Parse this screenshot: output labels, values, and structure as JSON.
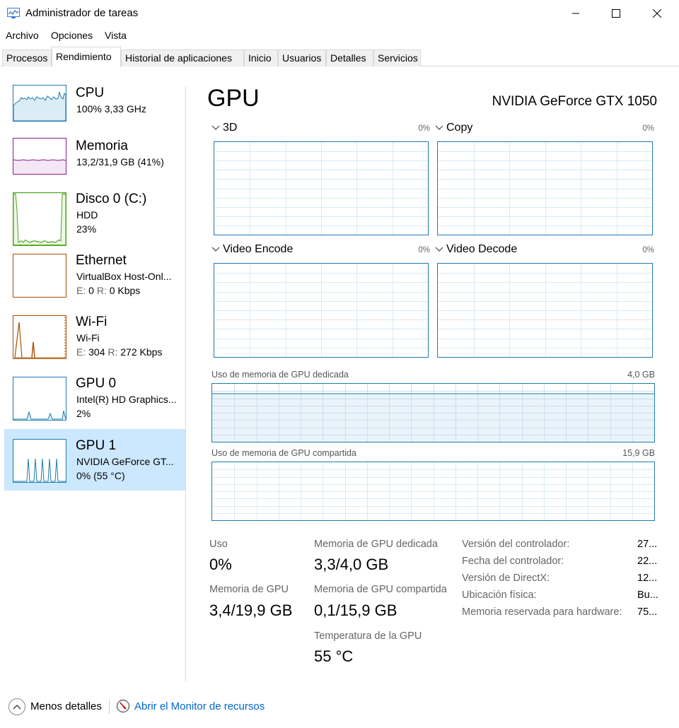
{
  "window": {
    "title": "Administrador de tareas"
  },
  "menu": [
    "Archivo",
    "Opciones",
    "Vista"
  ],
  "tabs": [
    "Procesos",
    "Rendimiento",
    "Historial de aplicaciones",
    "Inicio",
    "Usuarios",
    "Detalles",
    "Servicios"
  ],
  "active_tab": "Rendimiento",
  "sidebar": {
    "items": [
      {
        "title": "CPU",
        "line1": "100%  3,33 GHz",
        "line2": "",
        "color": "#1d7bae"
      },
      {
        "title": "Memoria",
        "line1": "13,2/31,9 GB (41%)",
        "line2": "",
        "color": "#8b1a8b"
      },
      {
        "title": "Disco 0 (C:)",
        "line1": "HDD",
        "line2": "23%",
        "color": "#4da41f"
      },
      {
        "title": "Ethernet",
        "line1": "VirtualBox Host-Onl...",
        "line2_prefix_s": "E:",
        "line2_s_val": "0",
        "line2_prefix_r": "R:",
        "line2_r_val": "0 Kbps",
        "color": "#a74f01"
      },
      {
        "title": "Wi-Fi",
        "line1": "Wi-Fi",
        "line2_prefix_s": "E:",
        "line2_s_val": "304",
        "line2_prefix_r": "R:",
        "line2_r_val": "272 Kbps",
        "color": "#a74f01"
      },
      {
        "title": "GPU 0",
        "line1": "Intel(R) HD Graphics...",
        "line2": "2%",
        "color": "#1d7bae"
      },
      {
        "title": "GPU 1",
        "line1": "NVIDIA GeForce GT...",
        "line2": "0% (55 °C)",
        "color": "#1d7bae"
      }
    ],
    "selected_index": 6
  },
  "main": {
    "title": "GPU",
    "model": "NVIDIA GeForce GTX 1050",
    "engines": [
      {
        "name": "3D",
        "pct": "0%"
      },
      {
        "name": "Copy",
        "pct": "0%"
      },
      {
        "name": "Video Encode",
        "pct": "0%"
      },
      {
        "name": "Video Decode",
        "pct": "0%"
      }
    ],
    "dedicated_mem_label": "Uso de memoria de GPU dedicada",
    "dedicated_mem_max": "4,0 GB",
    "dedicated_mem_fraction": 0.83,
    "shared_mem_label": "Uso de memoria de GPU compartida",
    "shared_mem_max": "15,9 GB",
    "stats": {
      "uso_label": "Uso",
      "uso_value": "0%",
      "mem_gpu_label": "Memoria de GPU",
      "mem_gpu_value": "3,4/19,9 GB",
      "ded_label": "Memoria de GPU dedicada",
      "ded_value": "3,3/4,0 GB",
      "shared_label": "Memoria de GPU compartida",
      "shared_value": "0,1/15,9 GB",
      "temp_label": "Temperatura de la GPU",
      "temp_value": "55 °C"
    },
    "info": [
      {
        "label": "Versión del controlador:",
        "value": "27..."
      },
      {
        "label": "Fecha del controlador:",
        "value": "22..."
      },
      {
        "label": "Versión de DirectX:",
        "value": "12..."
      },
      {
        "label": "Ubicación física:",
        "value": "Bu..."
      },
      {
        "label": "Memoria reservada para hardware:",
        "value": "75..."
      }
    ]
  },
  "footer": {
    "less_details": "Menos detalles",
    "resource_monitor": "Abrir el Monitor de recursos"
  }
}
